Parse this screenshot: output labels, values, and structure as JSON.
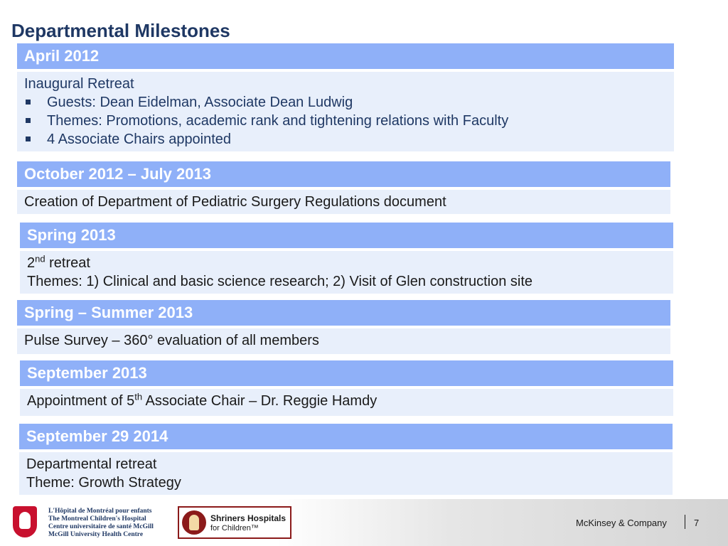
{
  "title": "Departmental Milestones",
  "milestones": [
    {
      "period": "April 2012",
      "heading": "Inaugural Retreat",
      "bullets": [
        "Guests:  Dean Eidelman, Associate Dean Ludwig",
        "Themes:  Promotions, academic rank and tightening relations with Faculty",
        "4 Associate Chairs appointed"
      ]
    },
    {
      "period": "October 2012 – July 2013",
      "text": "Creation of Department of Pediatric Surgery Regulations document"
    },
    {
      "period": "Spring 2013",
      "line1_num": "2",
      "line1_sup": "nd",
      "line1_rest": " retreat",
      "line2": "Themes:  1)  Clinical and basic science research;  2) Visit of Glen construction site"
    },
    {
      "period": "Spring – Summer 2013",
      "text": "Pulse Survey – 360° evaluation of all members"
    },
    {
      "period": "September 2013",
      "pre": "Appointment of 5",
      "sup": "th",
      "post": " Associate Chair – Dr. Reggie Hamdy"
    },
    {
      "period": "September 29 2014",
      "line1": "Departmental retreat",
      "line2": "Theme:  Growth Strategy"
    }
  ],
  "footer": {
    "mch_lines": [
      "L'Hôpital de Montréal pour enfants",
      "The Montreal Children's Hospital",
      "Centre universitaire de santé McGill",
      "McGill University Health Centre"
    ],
    "shriners_name": "Shriners Hospitals",
    "shriners_sub": "for Children™",
    "company": "McKinsey & Company",
    "page": "7"
  }
}
